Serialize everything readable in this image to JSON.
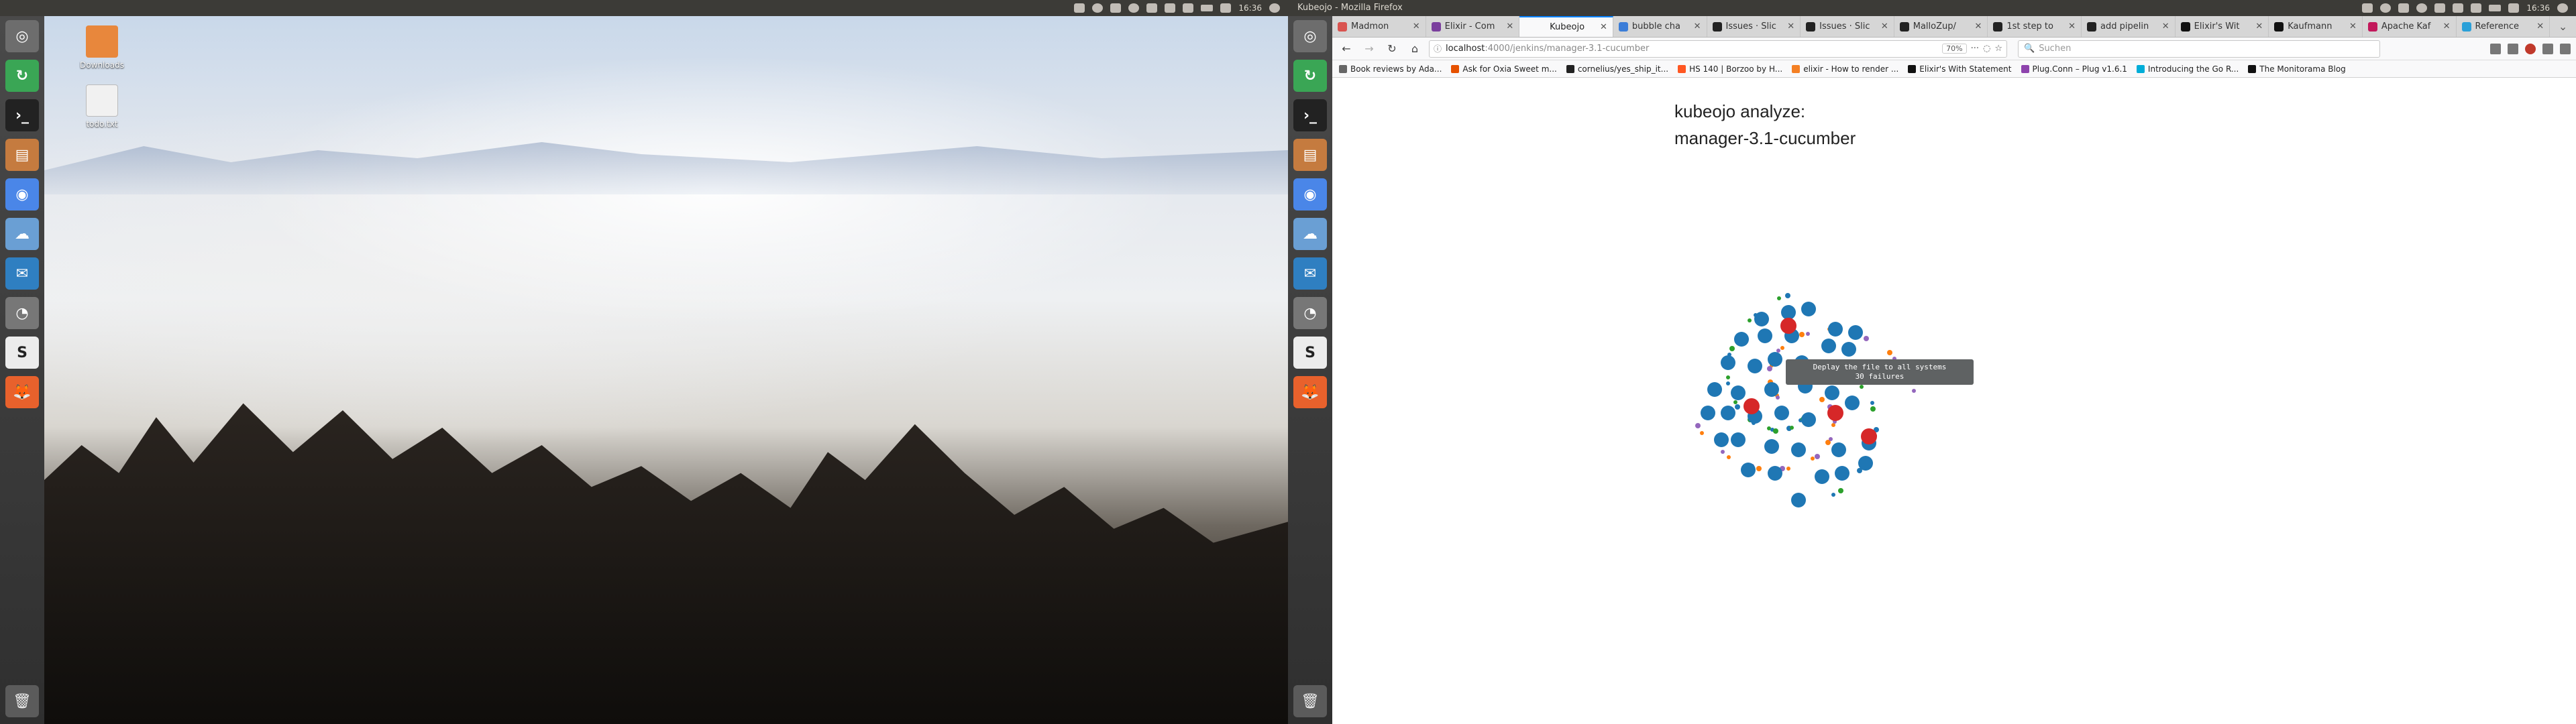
{
  "left": {
    "topbar_title": "",
    "tray_time": "16:36",
    "desktop_icons": [
      "Downloads",
      "todo.txt"
    ]
  },
  "right": {
    "window_title": "Kubeojo - Mozilla Firefox",
    "tray_time": "16:36",
    "tabs": [
      {
        "label": "Madmon",
        "color": "#d9534f"
      },
      {
        "label": "Elixir - Com",
        "color": "#7a3e9d"
      },
      {
        "label": "Kubeojo",
        "color": "#ffffff",
        "active": true
      },
      {
        "label": "bubble cha",
        "color": "#3b7dd8"
      },
      {
        "label": "Issues · Slic",
        "color": "#222222"
      },
      {
        "label": "Issues · Slic",
        "color": "#222222"
      },
      {
        "label": "MalloZup/",
        "color": "#222222"
      },
      {
        "label": "1st step to",
        "color": "#222222"
      },
      {
        "label": "add pipelin",
        "color": "#222222"
      },
      {
        "label": "Elixir's Wit",
        "color": "#111111"
      },
      {
        "label": "Kaufmann",
        "color": "#111111"
      },
      {
        "label": "Apache Kaf",
        "color": "#c2185b"
      },
      {
        "label": "Reference",
        "color": "#2aa0d8"
      }
    ],
    "url_host": "localhost",
    "url_path": ":4000/jenkins/manager-3.1-cucumber",
    "zoom": "70%",
    "search_placeholder": "Suchen",
    "bookmarks": [
      {
        "label": "Book reviews by Ada...",
        "color": "#666666"
      },
      {
        "label": "Ask for Oxia Sweet m...",
        "color": "#e65100"
      },
      {
        "label": "cornelius/yes_ship_it...",
        "color": "#222222"
      },
      {
        "label": "HS 140 | Borzoo by H...",
        "color": "#ff5722"
      },
      {
        "label": "elixir - How to render ...",
        "color": "#f48024"
      },
      {
        "label": "Elixir's With Statement",
        "color": "#111111"
      },
      {
        "label": "Plug.Conn – Plug v1.6.1",
        "color": "#8e44ad"
      },
      {
        "label": "Introducing the Go R...",
        "color": "#00add8"
      },
      {
        "label": "The Monitorama Blog",
        "color": "#111111"
      }
    ],
    "page": {
      "title_line1": "kubeojo analyze:",
      "title_line2": "manager-3.1-cucumber",
      "tooltip_line1": "Deplay the file to all systems",
      "tooltip_line2": "30 failures"
    },
    "colors": {
      "blue": "#1f77b4",
      "red": "#d62728",
      "orange": "#ff7f0e",
      "green": "#2ca02c",
      "purple": "#9467bd"
    }
  }
}
